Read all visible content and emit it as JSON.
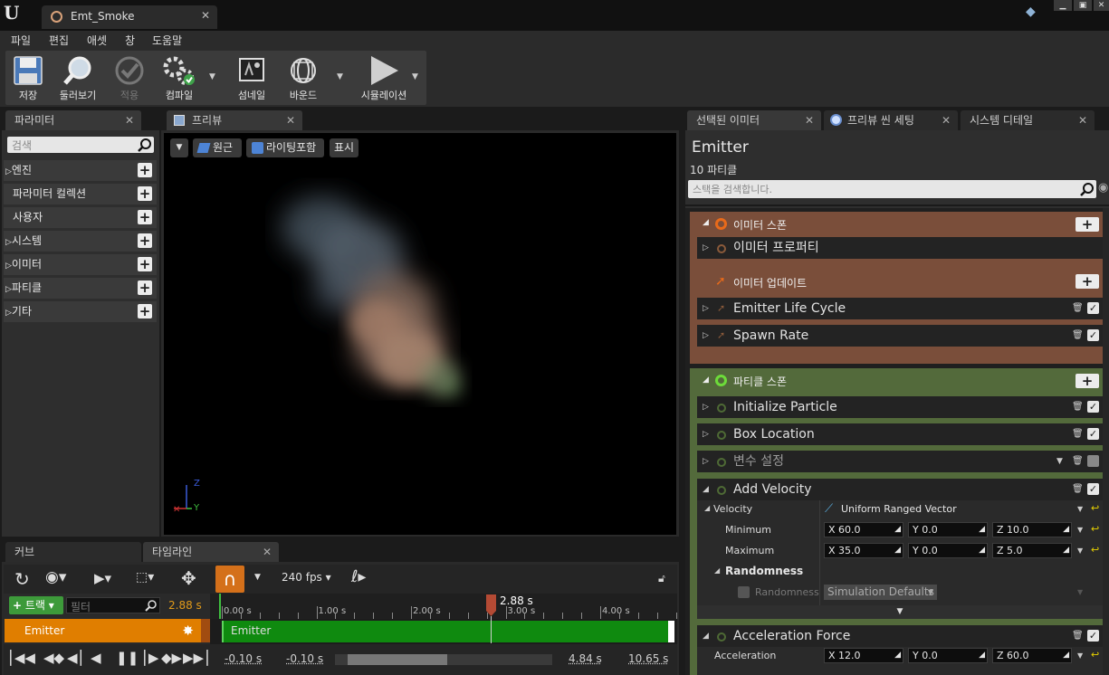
{
  "window": {
    "tab_title": "Emt_Smoke"
  },
  "menu": [
    "파일",
    "편집",
    "애셋",
    "창",
    "도움말"
  ],
  "toolbar": {
    "save": "저장",
    "browse": "둘러보기",
    "apply": "적용",
    "compile": "컴파일",
    "thumbnail": "섬네일",
    "bounds": "바운드",
    "simulation": "시뮬레이션"
  },
  "params": {
    "tab": "파라미터",
    "search_placeholder": "검색",
    "categories": [
      "엔진",
      "파라미터 컬렉션",
      "사용자",
      "시스템",
      "이미터",
      "파티클",
      "기타"
    ]
  },
  "preview": {
    "tab": "프리뷰",
    "perspective": "원근",
    "lighting": "라이팅포함",
    "show": "표시",
    "axis_z": "Z",
    "axis_y": "Y"
  },
  "right_tabs": [
    "선택된 이미터",
    "프리뷰 씬 세팅",
    "시스템 디테일"
  ],
  "emitter": {
    "name": "Emitter",
    "particle_count": "10 파티클",
    "search_placeholder": "스택을 검색합니다."
  },
  "stack": {
    "emitter_spawn": "이미터 스폰",
    "emitter_properties": "이미터 프로퍼티",
    "emitter_update": "이미터 업데이트",
    "emitter_life_cycle": "Emitter Life Cycle",
    "spawn_rate": "Spawn Rate",
    "particle_spawn": "파티클 스폰",
    "initialize_particle": "Initialize Particle",
    "box_location": "Box Location",
    "set_variables": "변수 설정",
    "add_velocity": "Add Velocity",
    "velocity_label": "Velocity",
    "velocity_mode": "Uniform Ranged Vector",
    "minimum_label": "Minimum",
    "min": {
      "x": "X 60.0",
      "y": "Y 0.0",
      "z": "Z 10.0"
    },
    "maximum_label": "Maximum",
    "max": {
      "x": "X 35.0",
      "y": "Y 0.0",
      "z": "Z 5.0"
    },
    "randomness_header": "Randomness",
    "randomness_label": "Randomness",
    "randomness_value": "Simulation Defaults",
    "acceleration_force": "Acceleration Force",
    "acceleration_label": "Acceleration",
    "acc": {
      "x": "X 12.0",
      "y": "Y 0.0",
      "z": "Z 60.0"
    }
  },
  "bottom_tabs": {
    "curve": "커브",
    "timeline": "타임라인"
  },
  "timeline": {
    "fps": "240 fps",
    "track_button": "트랙",
    "filter_placeholder": "필터",
    "current_time": "2.88 s",
    "playhead": "2.88 s",
    "ticks": [
      "0.00 s",
      "1.00 s",
      "2.00 s",
      "3.00 s",
      "4.00 s"
    ],
    "track_name": "Emitter",
    "bar_label": "Emitter",
    "view_start": "-0.10 s",
    "range_start": "-0.10 s",
    "range_end": "4.84 s",
    "view_end": "10.65 s"
  },
  "colors": {
    "emitter_group": "#7a4e3a",
    "particle_group": "#536a3b",
    "track": "#e07e00",
    "timeline_bar": "#0f8a0f",
    "accent_orange": "#d4701a"
  }
}
